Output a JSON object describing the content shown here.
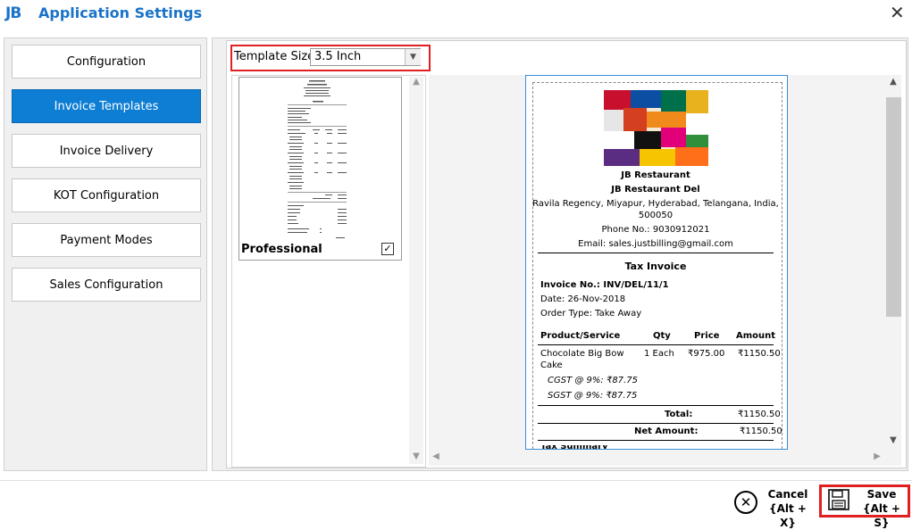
{
  "titlebar": {
    "logo": "JB",
    "title": "Application Settings",
    "close": "✕"
  },
  "nav": [
    {
      "label": "Configuration"
    },
    {
      "label": "Invoice Templates"
    },
    {
      "label": "Invoice Delivery"
    },
    {
      "label": "KOT Configuration"
    },
    {
      "label": "Payment Modes"
    },
    {
      "label": "Sales Configuration"
    }
  ],
  "template_size": {
    "label": "Template Size",
    "value": "3.5 Inch"
  },
  "template_list": [
    {
      "name": "Professional",
      "checked": true
    }
  ],
  "receipt": {
    "restaurant": "JB Restaurant",
    "branch": "JB Restaurant Del",
    "address": "Ravila Regency, Miyapur, Hyderabad, Telangana, India,",
    "zip": "500050",
    "phone": "Phone No.: 9030912021",
    "email": "Email: sales.justbilling@gmail.com",
    "heading": "Tax Invoice",
    "invoice_no": "Invoice No.: INV/DEL/11/1",
    "date": "Date: 26-Nov-2018",
    "order_type": "Order Type: Take Away",
    "columns": [
      "Product/Service",
      "Qty",
      "Price",
      "Amount"
    ],
    "item": {
      "name_line1": "Chocolate Big Bow",
      "name_line2": "Cake",
      "qty": "1 Each",
      "price": "₹975.00",
      "amount": "₹1150.50"
    },
    "cgst": "CGST @ 9%: ₹87.75",
    "sgst": "SGST @ 9%: ₹87.75",
    "total_label": "Total:",
    "total_value": "₹1150.50",
    "net_label": "Net Amount:",
    "net_value": "₹1150.50",
    "tax_summary": "Tax Summary"
  },
  "footer": {
    "cancel_label": "Cancel",
    "cancel_shortcut": "{Alt + X}",
    "save_label": "Save",
    "save_shortcut": "{Alt + S}"
  },
  "colors": {
    "accent": "#0d7ed4",
    "title": "#1a73c8",
    "highlight": "#e02020"
  }
}
